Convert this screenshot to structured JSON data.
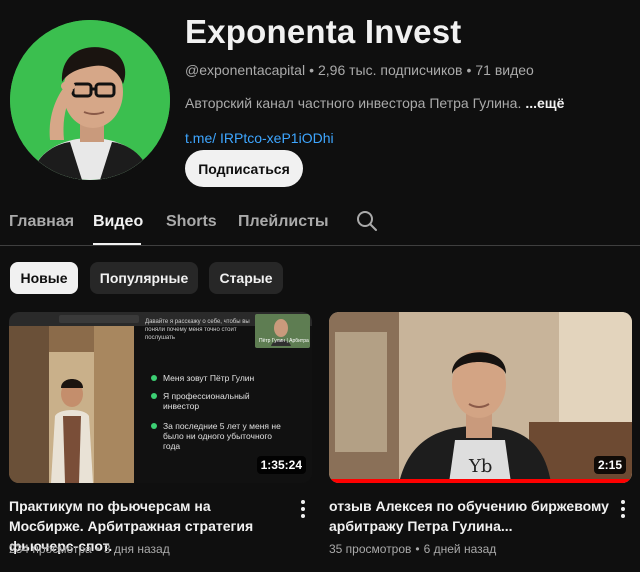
{
  "channel": {
    "name": "Exponenta Invest",
    "handle": "@exponentacapital",
    "subscribers": "2,96 тыс. подписчиков",
    "videos_count": "71 видео",
    "separator": "•",
    "description": "Авторский канал частного инвестора Петра Гулина.",
    "more_label": "...ещё",
    "link": "t.me/ IRPtco-xeP1iODhi",
    "subscribe_label": "Подписаться"
  },
  "tabs": [
    {
      "label": "Главная",
      "active": false
    },
    {
      "label": "Видео",
      "active": true
    },
    {
      "label": "Shorts",
      "active": false
    },
    {
      "label": "Плейлисты",
      "active": false
    }
  ],
  "chips": [
    {
      "label": "Новые",
      "selected": true
    },
    {
      "label": "Популярные",
      "selected": false
    },
    {
      "label": "Старые",
      "selected": false
    }
  ],
  "videos": [
    {
      "title": "Практикум по фьючерсам на Мосбирже. Арбитражная стратегия фьючерс-спот.",
      "views": "234 просмотра",
      "age": "3 дня назад",
      "duration": "1:35:24",
      "progress": 0,
      "slide": {
        "header_text": "Давайте я расскажу о себе, чтобы вы поняли почему меня точно стоит послушать",
        "webcam_name": "Пётр Гулин | Арбитра",
        "bullets": [
          "Меня зовут Пётр Гулин",
          "Я профессиональный инвестор",
          "За последние 5 лет у меня не было ни одного убыточного года"
        ]
      }
    },
    {
      "title": "отзыв Алексея по обучению биржевому арбитражу Петра Гулина...",
      "views": "35 просмотров",
      "age": "6 дней назад",
      "duration": "2:15",
      "progress": 100
    }
  ],
  "colors": {
    "background": "#0f0f0f",
    "text": "#f1f1f1",
    "secondary_text": "#aaaaaa",
    "link": "#3ea6ff",
    "chip_bg": "#272727",
    "avatar_bg": "#3bbf4f",
    "progress": "#ff0000"
  }
}
